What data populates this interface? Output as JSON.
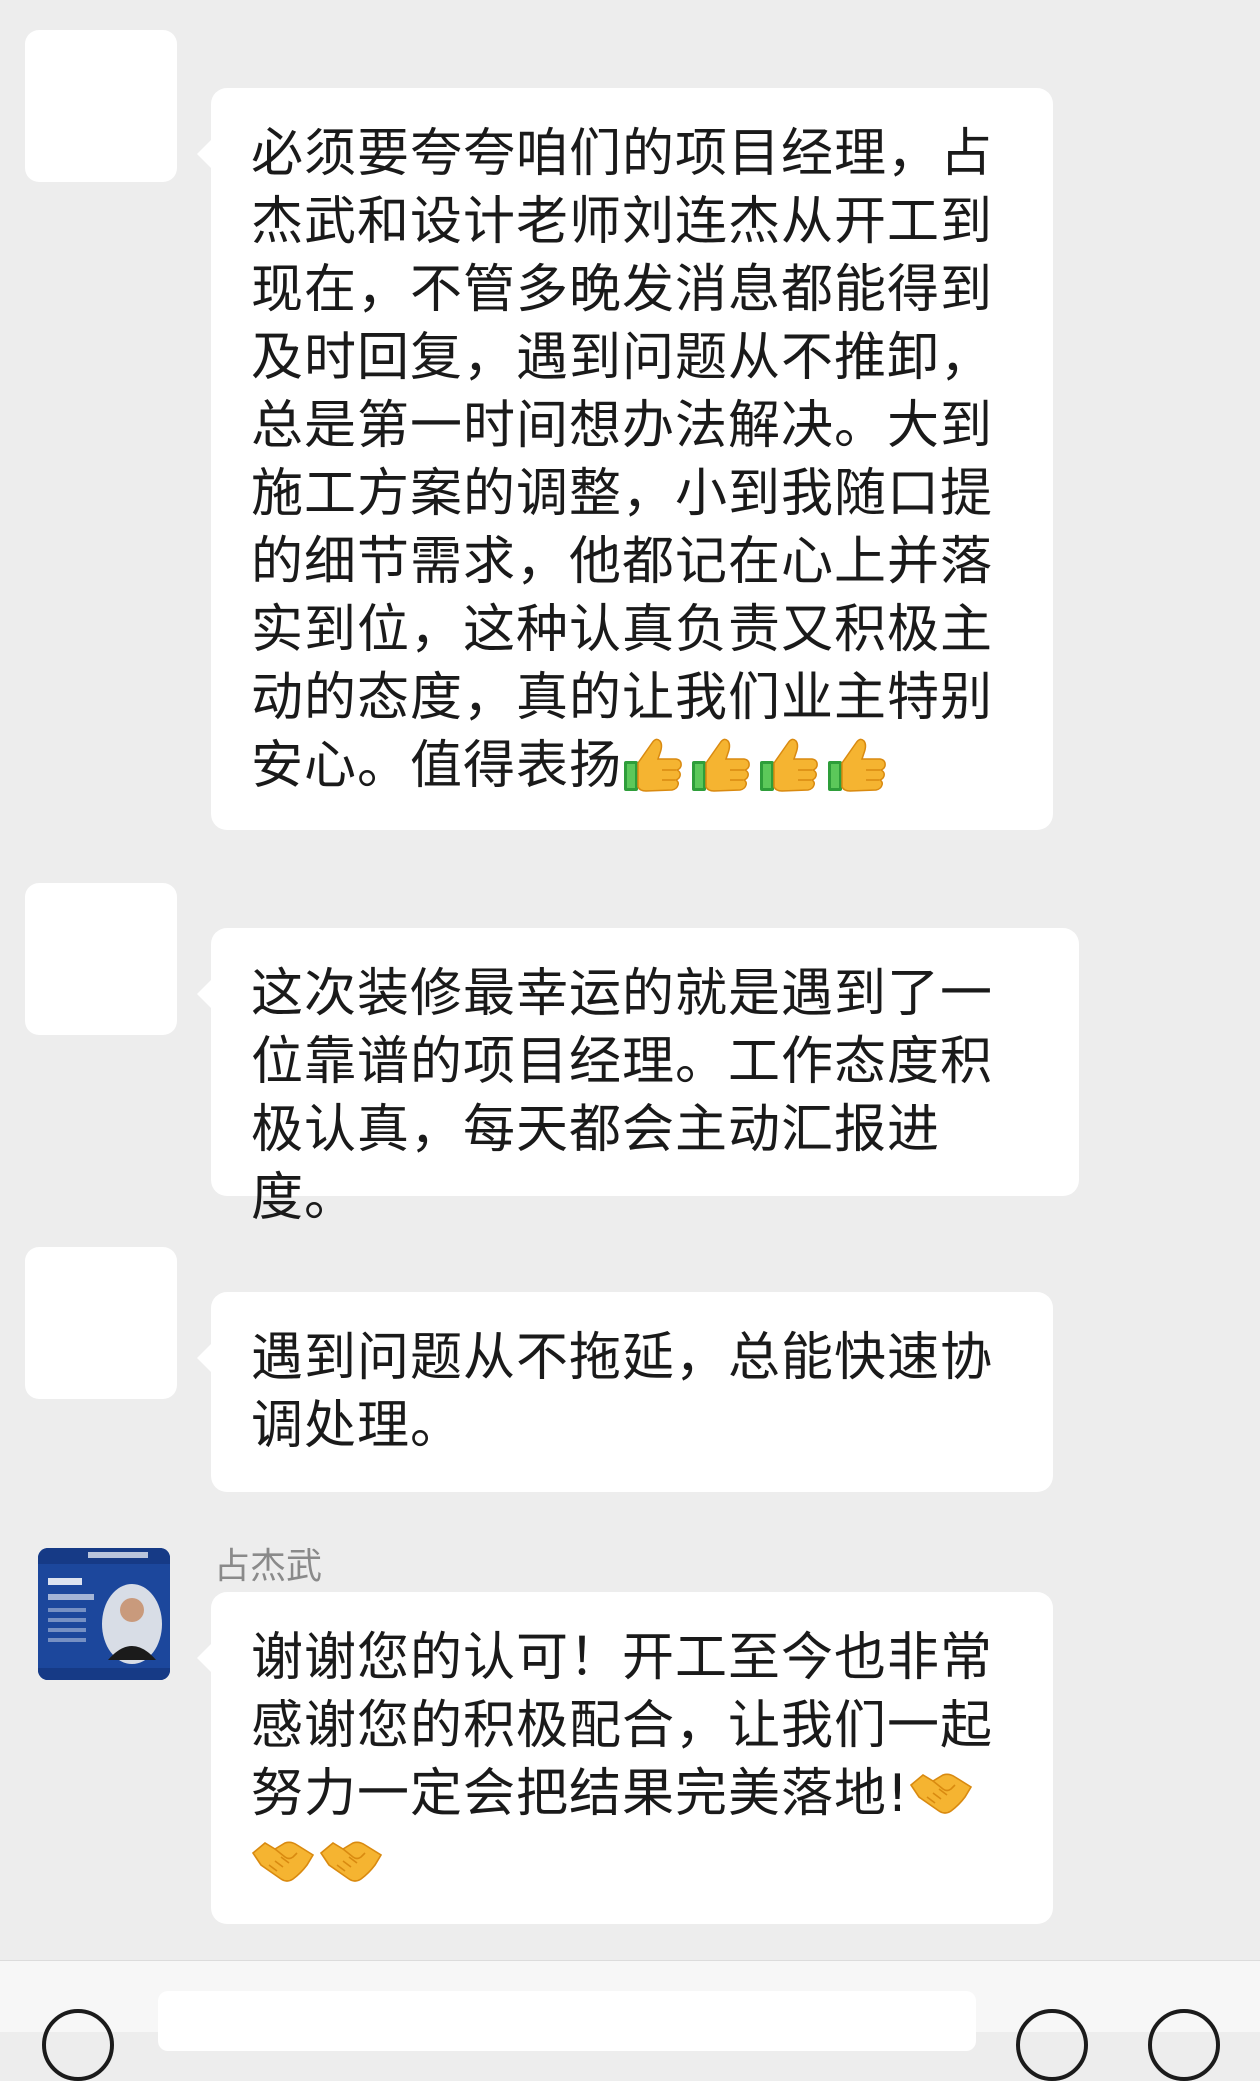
{
  "messages": [
    {
      "sender": "",
      "text": "必须要夸夸咱们的项目经理，占杰武和设计老师刘连杰从开工到现在，不管多晚发消息都能得到及时回复，遇到问题从不推卸，总是第一时间想办法解决。大到施工方案的调整，小到我随口提的细节需求，他都记在心上并落实到位，这种认真负责又积极主动的态度，真的让我们业主特别安心。值得表扬",
      "emoji": [
        "thumbs-up",
        "thumbs-up",
        "thumbs-up",
        "thumbs-up"
      ]
    },
    {
      "sender": "",
      "text": "这次装修最幸运的就是遇到了一位靠谱的项目经理。工作态度积极认真，每天都会主动汇报进度。"
    },
    {
      "sender": "",
      "text": "遇到问题从不拖延，总能快速协调处理。"
    },
    {
      "sender": "占杰武",
      "text": "谢谢您的认可！开工至今也非常感谢您的积极配合，让我们一起努力一定会把结果完美落地!",
      "emoji": [
        "handshake",
        "handshake",
        "handshake"
      ]
    }
  ],
  "colors": {
    "background": "#ededed",
    "bubble": "#ffffff",
    "text": "#1a1a1a",
    "sender_name": "#8a8a8a",
    "card_blue": "#1f4ea6"
  },
  "icons": {
    "bottom_left": "voice-icon",
    "bottom_right_1": "emoji-icon",
    "bottom_right_2": "plus-icon"
  }
}
